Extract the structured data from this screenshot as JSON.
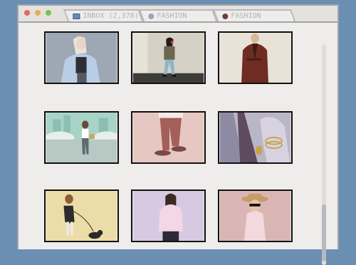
{
  "browser": {
    "tabs": [
      {
        "label": "INBOX (2,378)",
        "icon": "mail-icon"
      },
      {
        "label": "FASHION",
        "icon": "gray-circle-icon"
      },
      {
        "label": "FASHION",
        "icon": "brown-circle-icon"
      }
    ]
  },
  "gallery": {
    "images": [
      {
        "name": "blonde-woman-denim-jacket"
      },
      {
        "name": "woman-walking-street-phone"
      },
      {
        "name": "man-brown-suit"
      },
      {
        "name": "woman-city-park-handbag"
      },
      {
        "name": "legs-pink-trousers-loafers"
      },
      {
        "name": "hand-gold-bracelets"
      },
      {
        "name": "woman-walking-dog"
      },
      {
        "name": "woman-pink-sweater"
      },
      {
        "name": "girl-hat-sunglasses"
      }
    ]
  },
  "colors": {
    "background": "#6b8fb3",
    "window": "#efedeb",
    "border": "#a2a4a8"
  }
}
